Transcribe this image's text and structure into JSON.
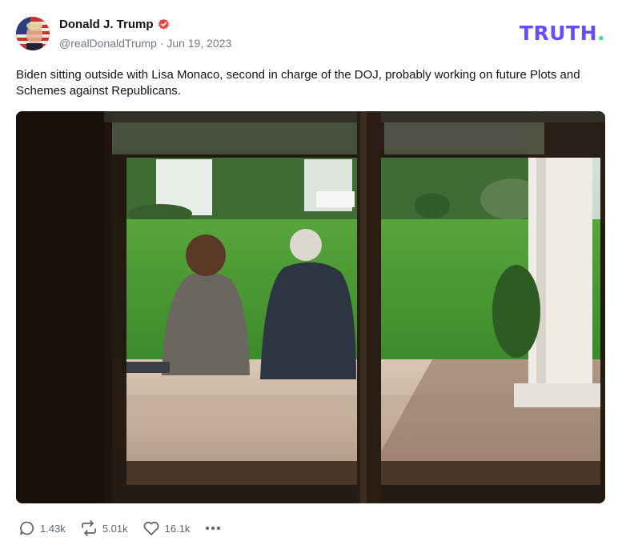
{
  "post": {
    "author_name": "Donald J. Trump",
    "handle": "@realDonaldTrump",
    "separator": "·",
    "date": "Jun 19, 2023",
    "text": "Biden sitting outside with Lisa Monaco, second in charge of the DOJ, probably working on future Plots and Schemes against Republicans."
  },
  "brand": {
    "logo_text": "TRUTH",
    "logo_dot": ".",
    "accent": "#6a4cff",
    "dot_color": "#2fd9a5",
    "verified_color": "#f04444"
  },
  "actions": {
    "replies": "1.43k",
    "retruths": "5.01k",
    "likes": "16.1k"
  },
  "icons": [
    "verified-badge-icon",
    "reply-icon",
    "retruth-icon",
    "like-icon",
    "more-icon"
  ]
}
